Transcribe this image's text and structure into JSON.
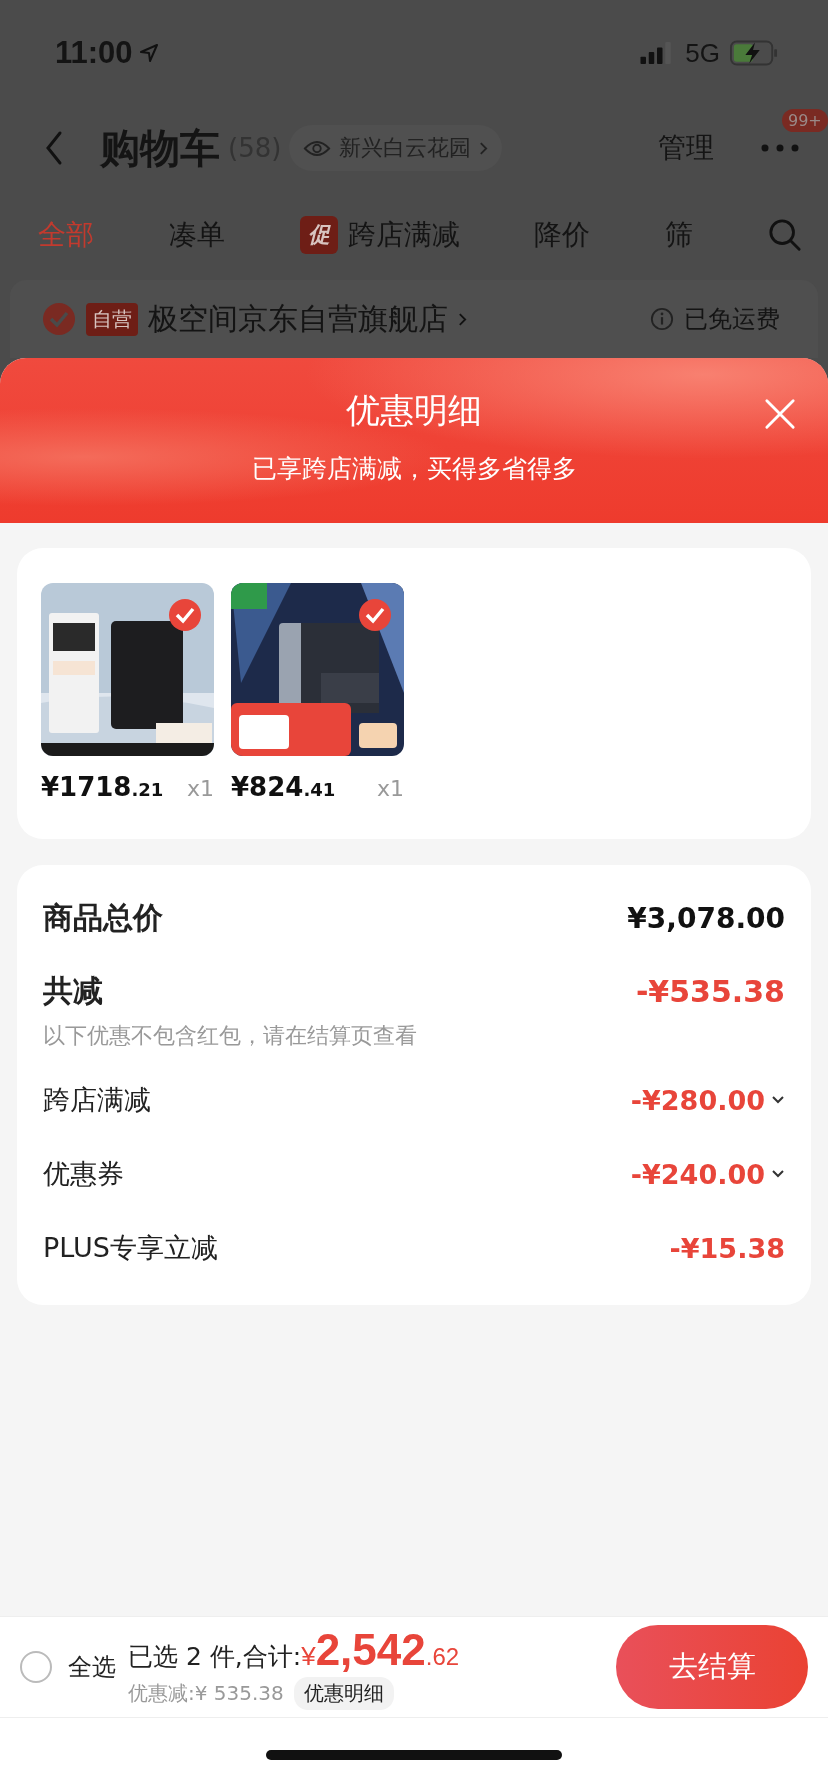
{
  "status_bar": {
    "time": "11:00",
    "network": "5G"
  },
  "nav": {
    "title": "购物车",
    "count": "(58)",
    "location": "新兴白云花园",
    "manage": "管理",
    "badge": "99+"
  },
  "tabs": [
    {
      "label": "全部",
      "selected": true
    },
    {
      "label": "凑单",
      "selected": false
    },
    {
      "label": "跨店满减",
      "selected": false,
      "tag": "促"
    },
    {
      "label": "降价",
      "selected": false
    },
    {
      "label": "筛",
      "selected": false
    }
  ],
  "store": {
    "checked": true,
    "tag": "自营",
    "name": "极空间京东自营旗舰店",
    "shipping": "已免运费"
  },
  "sheet": {
    "title": "优惠明细",
    "subtitle": "已享跨店满减，买得多省得多"
  },
  "products": [
    {
      "kind": "picture",
      "checked": true,
      "price_int": "¥1718",
      "price_dec": ".21",
      "qty": "x1"
    },
    {
      "kind": "picture",
      "checked": true,
      "price_int": "¥824",
      "price_dec": ".41",
      "qty": "x1"
    }
  ],
  "summary": [
    {
      "kind": "total",
      "label": "商品总价",
      "value": "¥3,078.00"
    },
    {
      "kind": "discount_total",
      "label": "共减",
      "value": "-¥535.38",
      "note": "以下优惠不包含红包，请在结算页查看"
    },
    {
      "kind": "item",
      "label": "跨店满减",
      "value": "-¥280.00",
      "expandable": true
    },
    {
      "kind": "item",
      "label": "优惠券",
      "value": "-¥240.00",
      "expandable": true
    },
    {
      "kind": "item",
      "label": "PLUS专享立减",
      "value": "-¥15.38",
      "expandable": false
    }
  ],
  "bottom": {
    "select_all": {
      "label": "全选",
      "checked": false
    },
    "selected_text": "已选 2 件,合计:",
    "currency": "¥",
    "total_int": "2,542",
    "total_dec": ".62",
    "saving": "优惠减:¥ 535.38",
    "detail_button": "优惠明细",
    "checkout": "去结算"
  }
}
